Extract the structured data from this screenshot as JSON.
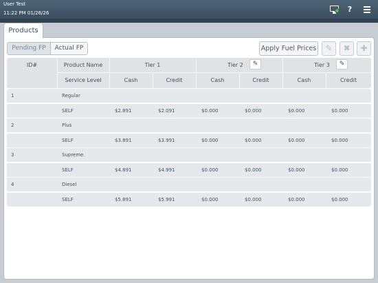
{
  "header": {
    "user": "User Test",
    "datetime": "11:22 PM 01/26/26",
    "icons": [
      "monitor-icon",
      "help-icon",
      "menu-icon"
    ],
    "help_glyph": "?"
  },
  "tabs": [
    {
      "label": "Products",
      "active": true
    }
  ],
  "toolbar": {
    "pending_label": "Pending FP",
    "actual_label": "Actual FP",
    "apply_label": "Apply Fuel Prices"
  },
  "table": {
    "col_id": "ID#",
    "col_product": "Product Name",
    "col_service": "Service Level",
    "tiers": [
      {
        "label": "Tier 1",
        "cash": "Cash",
        "credit": "Credit"
      },
      {
        "label": "Tier 2",
        "cash": "Cash",
        "credit": "Credit"
      },
      {
        "label": "Tier 3",
        "cash": "Cash",
        "credit": "Credit"
      }
    ],
    "products": [
      {
        "id": "1",
        "name": "Regular",
        "level": "SELF",
        "prices": [
          "$2.891",
          "$2.091",
          "$0.000",
          "$0.000",
          "$0.000",
          "$0.000"
        ]
      },
      {
        "id": "2",
        "name": "Plus",
        "level": "SELF",
        "prices": [
          "$3.891",
          "$3.991",
          "$0.000",
          "$0.000",
          "$0.000",
          "$0.000"
        ]
      },
      {
        "id": "3",
        "name": "Supreme",
        "level": "SELF",
        "prices": [
          "$4.891",
          "$4.991",
          "$0.000",
          "$0.000",
          "$0.000",
          "$0.000"
        ]
      },
      {
        "id": "4",
        "name": "Diesel",
        "level": "SELF",
        "prices": [
          "$5.891",
          "$5.991",
          "$0.000",
          "$0.000",
          "$0.000",
          "$0.000"
        ]
      }
    ]
  },
  "colors": {
    "topbar": "#3a4f60",
    "row_bg": "#e6e9ec",
    "header_bg": "#dfe3e6"
  }
}
